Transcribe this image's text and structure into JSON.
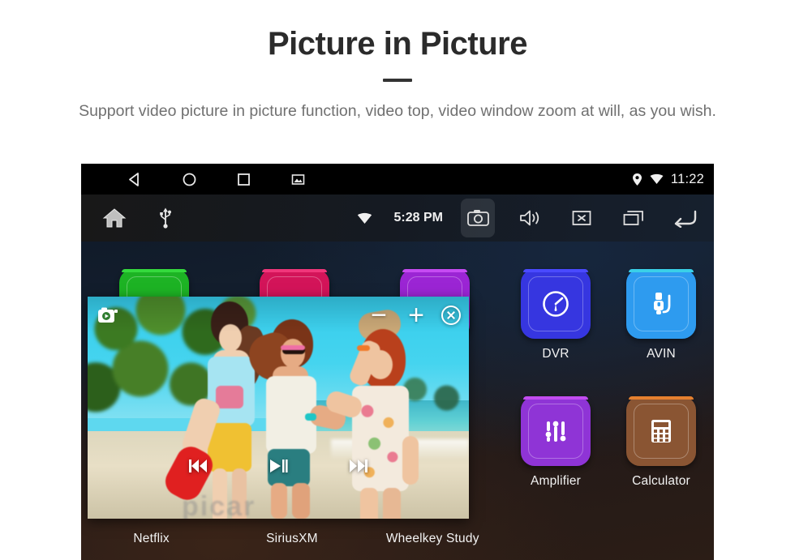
{
  "promo": {
    "title": "Picture in Picture",
    "subtitle": "Support video picture in picture function, video top, video window zoom at will, as you wish."
  },
  "device": {
    "status_bar": {
      "back_icon": "back-triangle-icon",
      "home_icon": "home-circle-icon",
      "recents_icon": "recents-square-icon",
      "screenshot_icon": "screenshot-image-icon",
      "location_icon": "location-pin-icon",
      "wifi_icon": "wifi-icon",
      "time": "11:22"
    },
    "toolbar": {
      "home_icon": "home-icon",
      "usb_icon": "usb-icon",
      "wifi_icon": "wifi-icon",
      "clock": "5:28 PM",
      "camera_icon": "camera-icon",
      "volume_icon": "volume-icon",
      "mute_icon": "mute-close-icon",
      "multiwindow_icon": "multiwindow-icon",
      "back_icon": "back-arrow-icon"
    },
    "apps": [
      {
        "label": "DVR",
        "icon": "dvr-gauge-icon",
        "color": "#3636e0",
        "top": "#4a4aff"
      },
      {
        "label": "AVIN",
        "icon": "avin-plug-icon",
        "color": "#2e9bef",
        "top": "#3ad0e8"
      },
      {
        "label": "Amplifier",
        "icon": "amplifier-eq-icon",
        "color": "#8f34d6",
        "top": "#c24cf0"
      },
      {
        "label": "Calculator",
        "icon": "calculator-icon",
        "color": "#8a5533",
        "top": "#e5802f"
      }
    ],
    "dock_apps": [
      {
        "label": "Netflix",
        "color": "#1db324",
        "top": "#35d93d"
      },
      {
        "label": "SiriusXM",
        "color": "#d31459",
        "top": "#f0367a"
      },
      {
        "label": "Wheelkey Study",
        "color": "#9b25d4",
        "top": "#c64bf2"
      }
    ],
    "pip": {
      "record_icon": "video-record-icon",
      "zoom_out_label": "−",
      "zoom_in_label": "+",
      "close_icon": "close-circle-icon",
      "prev_icon": "previous-track-icon",
      "play_icon": "play-pause-icon",
      "next_icon": "next-track-icon",
      "watermark": "picar"
    }
  }
}
